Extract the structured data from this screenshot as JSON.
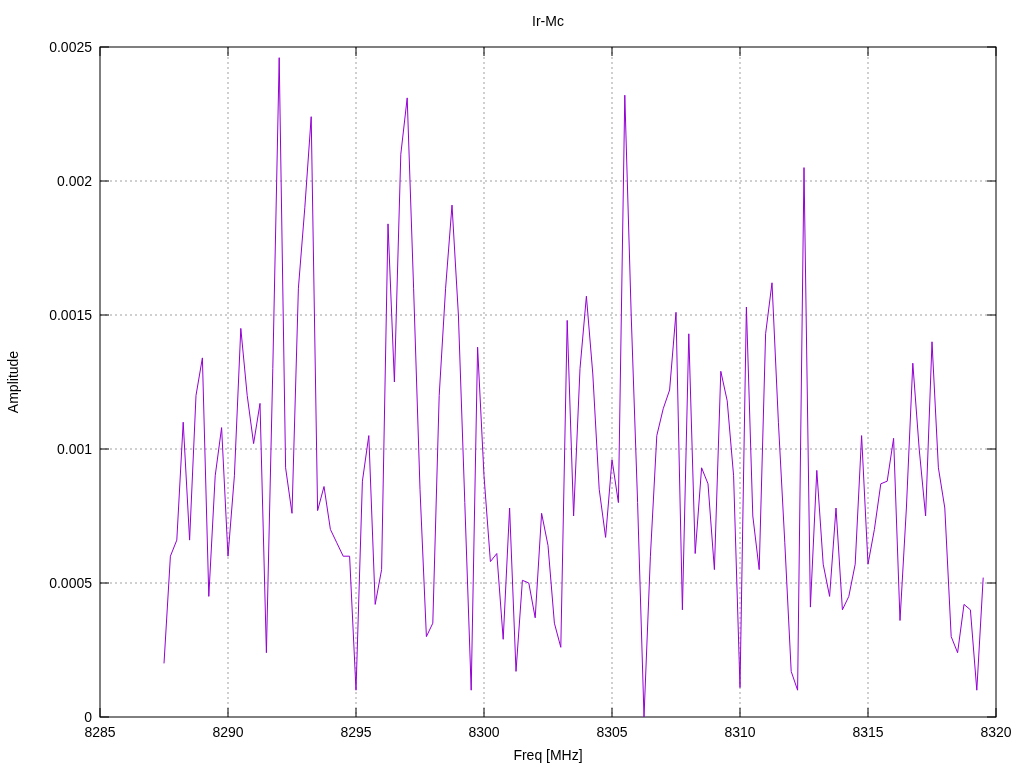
{
  "chart_data": {
    "type": "line",
    "title": "Ir-Mc",
    "xlabel": "Freq [MHz]",
    "ylabel": "Amplitude",
    "xlim": [
      8285,
      8320
    ],
    "ylim": [
      0,
      0.0025
    ],
    "xticks": [
      8285,
      8290,
      8295,
      8300,
      8305,
      8310,
      8315,
      8320
    ],
    "yticks": [
      0,
      0.0005,
      0.001,
      0.0015,
      0.002,
      0.0025
    ],
    "x": [
      8287.5,
      8287.75,
      8288,
      8288.25,
      8288.5,
      8288.75,
      8289,
      8289.25,
      8289.5,
      8289.75,
      8290,
      8290.25,
      8290.5,
      8290.75,
      8291,
      8291.25,
      8291.5,
      8291.75,
      8292,
      8292.25,
      8292.5,
      8292.75,
      8293,
      8293.25,
      8293.5,
      8293.75,
      8294,
      8294.25,
      8294.5,
      8294.75,
      8295,
      8295.25,
      8295.5,
      8295.75,
      8296,
      8296.25,
      8296.5,
      8296.75,
      8297,
      8297.25,
      8297.5,
      8297.75,
      8298,
      8298.25,
      8298.5,
      8298.75,
      8299,
      8299.25,
      8299.5,
      8299.75,
      8300,
      8300.25,
      8300.5,
      8300.75,
      8301,
      8301.25,
      8301.5,
      8301.75,
      8302,
      8302.25,
      8302.5,
      8302.75,
      8303,
      8303.25,
      8303.5,
      8303.75,
      8304,
      8304.25,
      8304.5,
      8304.75,
      8305,
      8305.25,
      8305.5,
      8305.75,
      8306,
      8306.25,
      8306.5,
      8306.75,
      8307,
      8307.25,
      8307.5,
      8307.75,
      8308,
      8308.25,
      8308.5,
      8308.75,
      8309,
      8309.25,
      8309.5,
      8309.75,
      8310,
      8310.25,
      8310.5,
      8310.75,
      8311,
      8311.25,
      8311.5,
      8311.75,
      8312,
      8312.25,
      8312.5,
      8312.75,
      8313,
      8313.25,
      8313.5,
      8313.75,
      8314,
      8314.25,
      8314.5,
      8314.75,
      8315,
      8315.25,
      8315.5,
      8315.75,
      8316,
      8316.25,
      8316.5,
      8316.75,
      8317,
      8317.25,
      8317.5,
      8317.75,
      8318,
      8318.25,
      8318.5,
      8318.75,
      8319,
      8319.25,
      8319.5
    ],
    "grid": true,
    "series": [
      {
        "color": "#9400d3",
        "values": [
          0.0002,
          0.0006,
          0.00066,
          0.0011,
          0.00066,
          0.0012,
          0.00134,
          0.00045,
          0.0009,
          0.00108,
          0.0006,
          0.0009,
          0.00145,
          0.0012,
          0.00102,
          0.00117,
          0.00024,
          0.0013,
          0.00246,
          0.00093,
          0.00076,
          0.0016,
          0.0019,
          0.00224,
          0.00077,
          0.00086,
          0.0007,
          0.00065,
          0.0006,
          0.0006,
          0.0001,
          0.00088,
          0.00105,
          0.00042,
          0.00055,
          0.00184,
          0.00125,
          0.0021,
          0.00231,
          0.0016,
          0.00085,
          0.0003,
          0.00035,
          0.0012,
          0.0016,
          0.00191,
          0.0015,
          0.0008,
          0.0001,
          0.00138,
          0.0009,
          0.00058,
          0.00061,
          0.00029,
          0.00078,
          0.00017,
          0.00051,
          0.0005,
          0.00037,
          0.00076,
          0.00064,
          0.00035,
          0.00026,
          0.00148,
          0.00075,
          0.0013,
          0.00157,
          0.00128,
          0.00085,
          0.00067,
          0.00096,
          0.0008,
          0.00232,
          0.0015,
          0.0008,
          0,
          0.0006,
          0.00105,
          0.00115,
          0.00122,
          0.00151,
          0.0004,
          0.00143,
          0.00061,
          0.00093,
          0.00087,
          0.00055,
          0.00129,
          0.00118,
          0.0009,
          0.00011,
          0.00153,
          0.00075,
          0.00055,
          0.00143,
          0.00162,
          0.0011,
          0.00065,
          0.00017,
          0.0001,
          0.00205,
          0.00041,
          0.00092,
          0.00057,
          0.00045,
          0.00078,
          0.0004,
          0.00045,
          0.00057,
          0.00105,
          0.00057,
          0.0007,
          0.00087,
          0.00088,
          0.00104,
          0.00036,
          0.00078,
          0.00132,
          0.001,
          0.00075,
          0.0014,
          0.00093,
          0.00078,
          0.0003,
          0.00024,
          0.00042,
          0.0004,
          0.0001,
          0.00052
        ]
      }
    ]
  }
}
